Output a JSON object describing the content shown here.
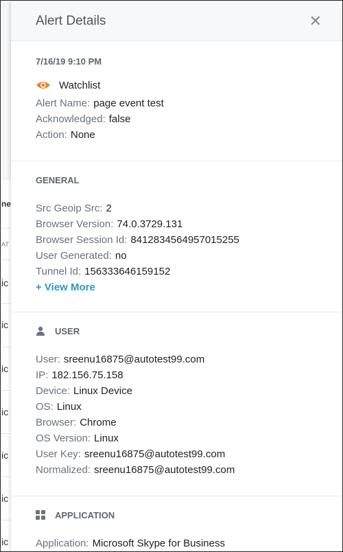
{
  "background_table": {
    "header_fragment": "ne",
    "subheader_fragment": "AT",
    "row_fragments": [
      "ic",
      "ic",
      "ic",
      "ic",
      "ic",
      "ic",
      "ic"
    ]
  },
  "panel": {
    "title": "Alert Details",
    "close_icon": "close-icon"
  },
  "alert": {
    "timestamp": "7/16/19 9:10 PM",
    "type_icon": "eye-icon",
    "type_label": "Watchlist",
    "type_color": "#f07d1a",
    "fields": [
      {
        "key": "Alert Name:",
        "value": "page event test"
      },
      {
        "key": "Acknowledged:",
        "value": "false"
      },
      {
        "key": "Action:",
        "value": "None"
      }
    ]
  },
  "general": {
    "heading": "GENERAL",
    "fields": [
      {
        "key": "Src Geoip Src:",
        "value": "2"
      },
      {
        "key": "Browser Version:",
        "value": "74.0.3729.131"
      },
      {
        "key": "Browser Session Id:",
        "value": "8412834564957015255"
      },
      {
        "key": "User Generated:",
        "value": "no"
      },
      {
        "key": "Tunnel Id:",
        "value": "156333646159152"
      }
    ],
    "view_more": "+ View More",
    "link_color": "#2a98cf"
  },
  "user": {
    "heading": "USER",
    "icon": "person-icon",
    "fields": [
      {
        "key": "User:",
        "value": "sreenu16875@autotest99.com"
      },
      {
        "key": "IP:",
        "value": "182.156.75.158"
      },
      {
        "key": "Device:",
        "value": "Linux Device"
      },
      {
        "key": "OS:",
        "value": "Linux"
      },
      {
        "key": "Browser:",
        "value": "Chrome"
      },
      {
        "key": "OS Version:",
        "value": "Linux"
      },
      {
        "key": "User Key:",
        "value": "sreenu16875@autotest99.com"
      },
      {
        "key": "Normalized:",
        "value": "sreenu16875@autotest99.com"
      }
    ]
  },
  "application": {
    "heading": "APPLICATION",
    "icon": "grid-icon",
    "fields": [
      {
        "key": "Application:",
        "value": "Microsoft Skype for Business"
      }
    ]
  }
}
